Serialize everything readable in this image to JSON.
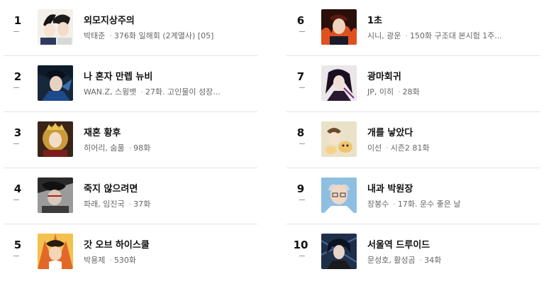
{
  "ranking": {
    "left": [
      {
        "rank": "1",
        "title": "외모지상주의",
        "author": "박태준",
        "episodes": "376화 일해회 (2계열사) [05]",
        "change": "–"
      },
      {
        "rank": "2",
        "title": "나 혼자 만렙 뉴비",
        "author": "WAN.Z, 스윙뱃",
        "episodes": "27화. 고인물이 성장...",
        "change": "–"
      },
      {
        "rank": "3",
        "title": "재혼 황후",
        "author": "히어리, 숨풀",
        "episodes": "98화",
        "change": "–"
      },
      {
        "rank": "4",
        "title": "죽지 않으려면",
        "author": "파래, 임진국",
        "episodes": "37화",
        "change": "–"
      },
      {
        "rank": "5",
        "title": "갓 오브 하이스쿨",
        "author": "박용제",
        "episodes": "530화",
        "change": "–"
      }
    ],
    "right": [
      {
        "rank": "6",
        "title": "1초",
        "author": "시니, 광운",
        "episodes": "150화 구조대 본시험 1주...",
        "change": "–"
      },
      {
        "rank": "7",
        "title": "광마회귀",
        "author": "JP, 이히",
        "episodes": "28화",
        "change": "–"
      },
      {
        "rank": "8",
        "title": "개를 낳았다",
        "author": "이선",
        "episodes": "시즌2 81화",
        "change": "–"
      },
      {
        "rank": "9",
        "title": "내과 박원장",
        "author": "장봉수",
        "episodes": "17화. 운수 좋은 날",
        "change": "–"
      },
      {
        "rank": "10",
        "title": "서울역 드루이드",
        "author": "문성호, 활성곰",
        "episodes": "34화",
        "change": "–"
      }
    ]
  }
}
